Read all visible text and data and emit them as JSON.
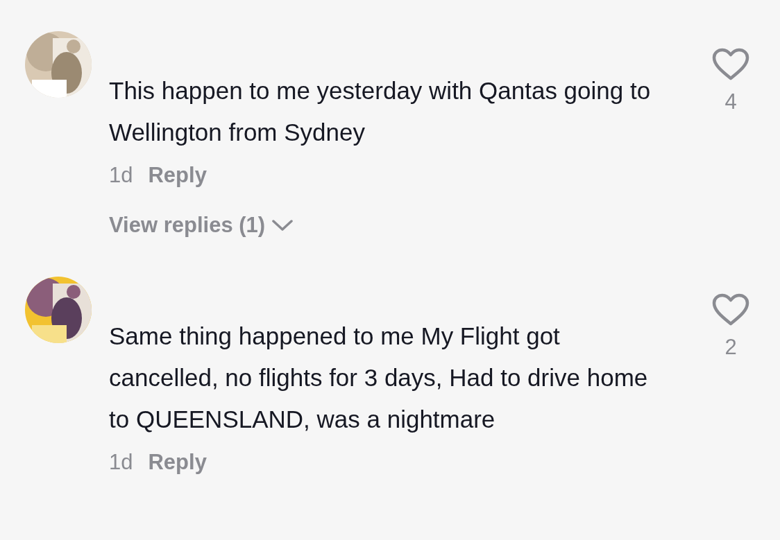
{
  "comments": [
    {
      "text": "This happen to me yesterday with Qantas going to Wellington from Sydney",
      "age": "1d",
      "reply_label": "Reply",
      "view_replies": "View replies (1)",
      "likes": "4"
    },
    {
      "text": "Same thing happened to me My Flight got cancelled, no flights for 3 days, Had to drive home to QUEENSLAND, was a nightmare",
      "age": "1d",
      "reply_label": "Reply",
      "likes": "2"
    }
  ]
}
